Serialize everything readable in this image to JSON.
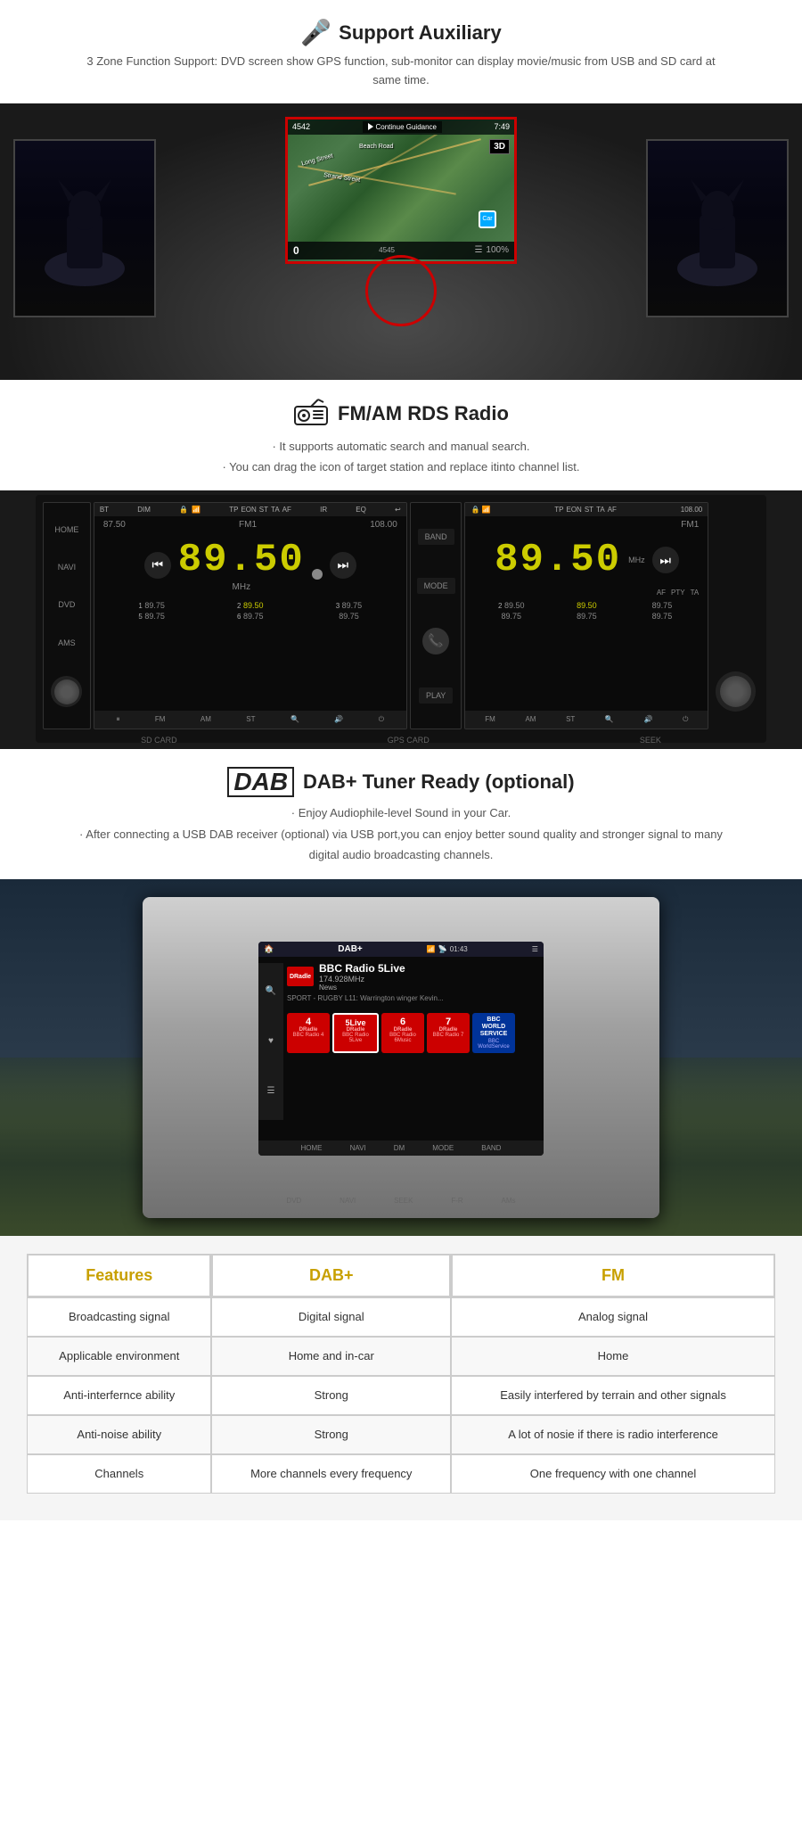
{
  "auxiliary": {
    "title": "Support Auxiliary",
    "description": "3 Zone Function Support: DVD screen show GPS function, sub-monitor can display movie/music from USB and SD card at same time.",
    "gps": {
      "topbar_left": "4542",
      "continue_text": "Continue Guidance",
      "time": "7:49",
      "mode": "3D",
      "bottom_number": "4545"
    }
  },
  "radio": {
    "title": "FM/AM RDS Radio",
    "bullet1": "· It supports automatic search and manual search.",
    "bullet2": "· You can drag the icon of target station and replace itinto channel list.",
    "frequency": "89.50",
    "freq_left": "87.50",
    "freq_right": "108.00",
    "mhz": "MHz",
    "fm_label": "FM1",
    "presets": [
      {
        "num": "1",
        "val": "89.75"
      },
      {
        "num": "2",
        "val": "89.50",
        "active": true
      },
      {
        "num": "3",
        "val": "89.75"
      },
      {
        "num": "5",
        "val": "89.75"
      },
      {
        "num": "6",
        "val": "89.75"
      },
      {
        "num": "",
        "val": "89.75"
      }
    ],
    "bottom_items": [
      "FM",
      "AM",
      "ST",
      "🔍",
      "🔊",
      "⏻"
    ],
    "side_items": [
      "HOME",
      "NAVI",
      "DVD",
      "AMS"
    ],
    "right_buttons": [
      "BAND",
      "MODE",
      "PLAY"
    ],
    "bottom_labels": [
      "SD CARD",
      "GPS CARD",
      "SEEK"
    ]
  },
  "dab": {
    "title": "DAB+ Tuner Ready (optional)",
    "bullet1": "· Enjoy Audiophile-level Sound in your Car.",
    "bullet2": "· After connecting a USB DAB receiver (optional) via USB port,you can enjoy better sound quality and stronger signal to many digital audio broadcasting channels.",
    "screen": {
      "logo": "DAB+",
      "time": "01:43",
      "station_name": "BBC Radio 5Live",
      "frequency": "174.928MHz",
      "category": "News",
      "sport_text": "SPORT - RUGBY L11: Warrington winger Kevin..."
    },
    "channels": [
      {
        "label": "4",
        "brand": "DRadle",
        "name": "BBC Radio 4"
      },
      {
        "label": "5Live",
        "brand": "DRadle",
        "name": "BBC Radio 5Live"
      },
      {
        "label": "6",
        "brand": "DRadle",
        "name": "BBC Radio 6Music"
      },
      {
        "label": "7",
        "brand": "DRadle",
        "name": "BBC Radio 7"
      },
      {
        "label": "BBC\nWORLD\nSERVICE",
        "brand": "",
        "name": "BBC WorldService"
      }
    ]
  },
  "comparison": {
    "headers": [
      "Features",
      "DAB+",
      "FM"
    ],
    "rows": [
      {
        "feature": "Broadcasting signal",
        "dab": "Digital signal",
        "fm": "Analog signal"
      },
      {
        "feature": "Applicable environment",
        "dab": "Home and in-car",
        "fm": "Home"
      },
      {
        "feature": "Anti-interfernce ability",
        "dab": "Strong",
        "fm": "Easily interfered by terrain and other signals"
      },
      {
        "feature": "Anti-noise ability",
        "dab": "Strong",
        "fm": "A lot of nosie if there is radio interference"
      },
      {
        "feature": "Channels",
        "dab": "More channels every frequency",
        "fm": "One frequency with one channel"
      }
    ]
  },
  "icons": {
    "mic_unicode": "🎤",
    "radio_unicode": "📻",
    "dab_text": "DAB"
  }
}
